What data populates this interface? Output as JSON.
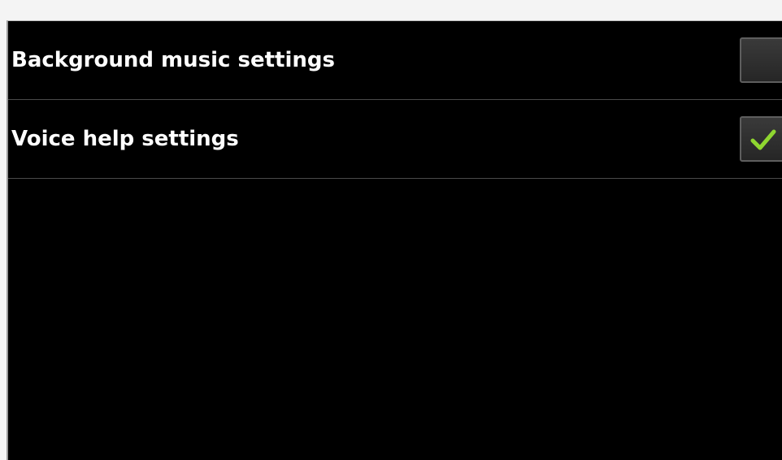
{
  "settings": {
    "items": [
      {
        "label": "Background music settings",
        "checked": false
      },
      {
        "label": "Voice help settings",
        "checked": true
      }
    ]
  },
  "colors": {
    "background": "#000000",
    "text": "#ffffff",
    "checkmark": "#8fd630",
    "divider": "#4a4a4a"
  },
  "icons": {
    "check": "checkmark-icon"
  }
}
